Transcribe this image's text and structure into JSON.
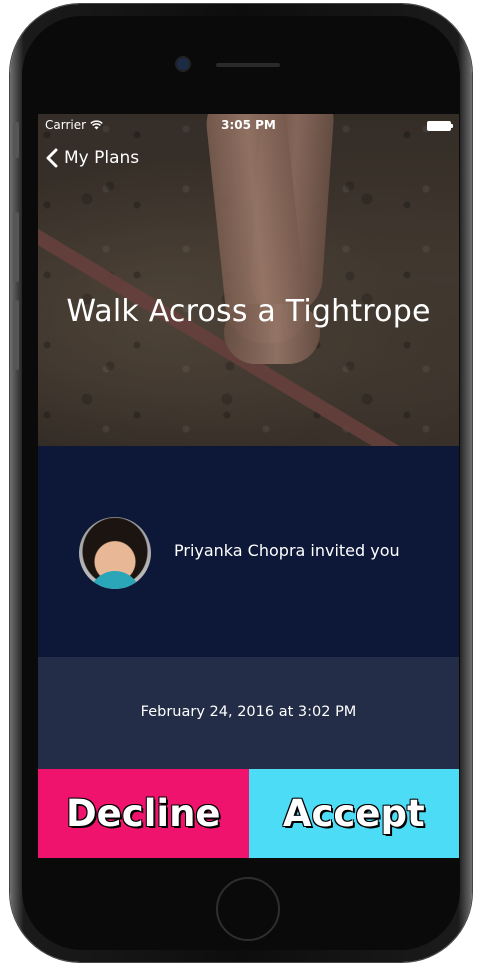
{
  "status_bar": {
    "carrier": "Carrier",
    "time": "3:05 PM"
  },
  "nav": {
    "back_label": "My Plans"
  },
  "plan": {
    "title": "Walk Across a Tightrope"
  },
  "invite": {
    "text": "Priyanka Chopra invited you"
  },
  "date": {
    "text": "February 24, 2016 at 3:02 PM"
  },
  "actions": {
    "decline_label": "Decline",
    "accept_label": "Accept"
  },
  "colors": {
    "decline": "#f0136e",
    "accept": "#4ddcf6",
    "invite_bg": "#0d1838",
    "date_bg": "#232d47"
  }
}
